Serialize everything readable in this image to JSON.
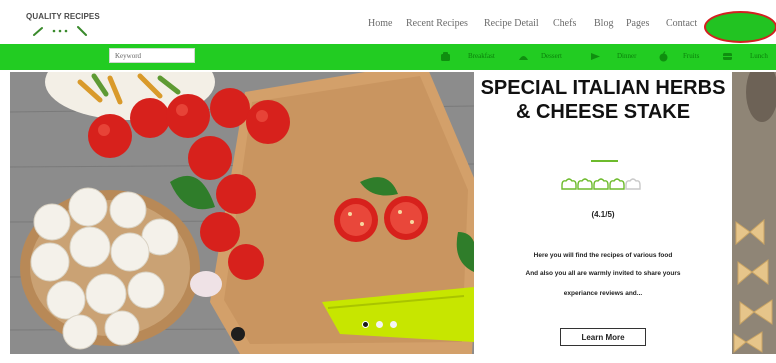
{
  "logo": {
    "text": "QUALITY RECIPES",
    "icon": "whisk-and-dots-icon"
  },
  "nav": {
    "items": [
      {
        "label": "Home"
      },
      {
        "label": "Recent Recipes"
      },
      {
        "label": "Recipe Detail"
      },
      {
        "label": "Chefs"
      },
      {
        "label": "Blog"
      },
      {
        "label": "Pages"
      },
      {
        "label": "Contact"
      }
    ]
  },
  "search": {
    "placeholder": "Keyword",
    "value": ""
  },
  "categories": [
    {
      "label": "Breakfast",
      "icon": "breakfast-icon"
    },
    {
      "label": "Dessert",
      "icon": "dessert-icon"
    },
    {
      "label": "Dinner",
      "icon": "dinner-icon"
    },
    {
      "label": "Fruits",
      "icon": "fruit-icon"
    },
    {
      "label": "Lunch",
      "icon": "lunch-icon"
    }
  ],
  "hero": {
    "image": "mushrooms-tomatoes-cutting-board-photo",
    "slides": 3,
    "active_slide": 1
  },
  "card": {
    "title": "SPECIAL ITALIAN HERBS & CHEESE STAKE",
    "rating_display": "(4.1/5)",
    "rating_value": 4.1,
    "rating_max": 5,
    "rating_icon": "chef-hat-icon",
    "lines": [
      "Here you will find the recipes of various food",
      "And also you all are warmly invited to share yours",
      "experiance reviews and..."
    ],
    "button_label": "Learn More"
  },
  "colors": {
    "brand_green": "#22cc22",
    "accent_divider": "#6dbb2c",
    "highlight_ring": "#d32020",
    "nav_text": "#6a6a6a",
    "category_text": "#0a7f0a"
  }
}
